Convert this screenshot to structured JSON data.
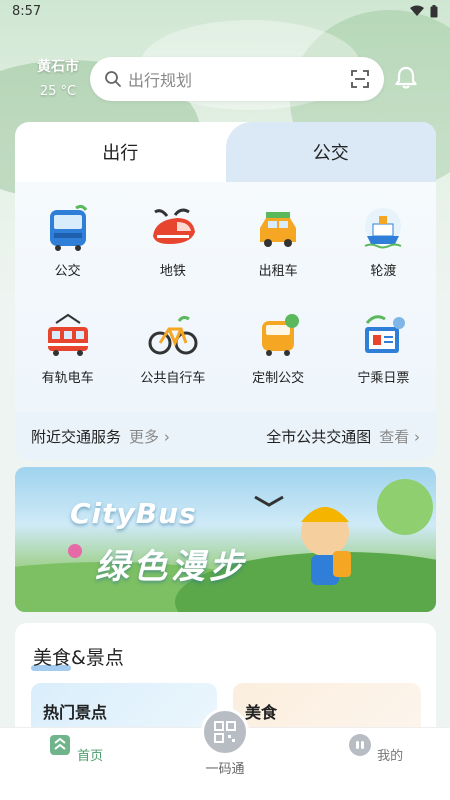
{
  "status": {
    "time": "8:57"
  },
  "location": {
    "city": "黄石市",
    "temperature": "25 °C"
  },
  "search": {
    "placeholder": "出行规划"
  },
  "transit": {
    "tabs": [
      "出行",
      "公交"
    ],
    "items": [
      {
        "label": "公交",
        "icon": "bus-icon"
      },
      {
        "label": "地铁",
        "icon": "metro-icon"
      },
      {
        "label": "出租车",
        "icon": "taxi-icon"
      },
      {
        "label": "轮渡",
        "icon": "ferry-icon"
      },
      {
        "label": "有轨电车",
        "icon": "tram-icon"
      },
      {
        "label": "公共自行车",
        "icon": "bicycle-icon"
      },
      {
        "label": "定制公交",
        "icon": "custom-bus-icon"
      },
      {
        "label": "宁乘日票",
        "icon": "day-ticket-icon"
      }
    ],
    "footer": {
      "nearby": "附近交通服务",
      "nearby_more": "更多",
      "citymap": "全市公共交通图",
      "citymap_more": "查看"
    }
  },
  "banner": {
    "title": "CityBus",
    "subtitle": "绿色漫步"
  },
  "food": {
    "title": "美食&景点",
    "cards": [
      "热门景点",
      "美食"
    ]
  },
  "nav": {
    "home": "首页",
    "qr": "一码通",
    "mine": "我的"
  },
  "colors": {
    "accent": "#4a9e6a",
    "card_tab_blue": "#dbe9f6"
  }
}
